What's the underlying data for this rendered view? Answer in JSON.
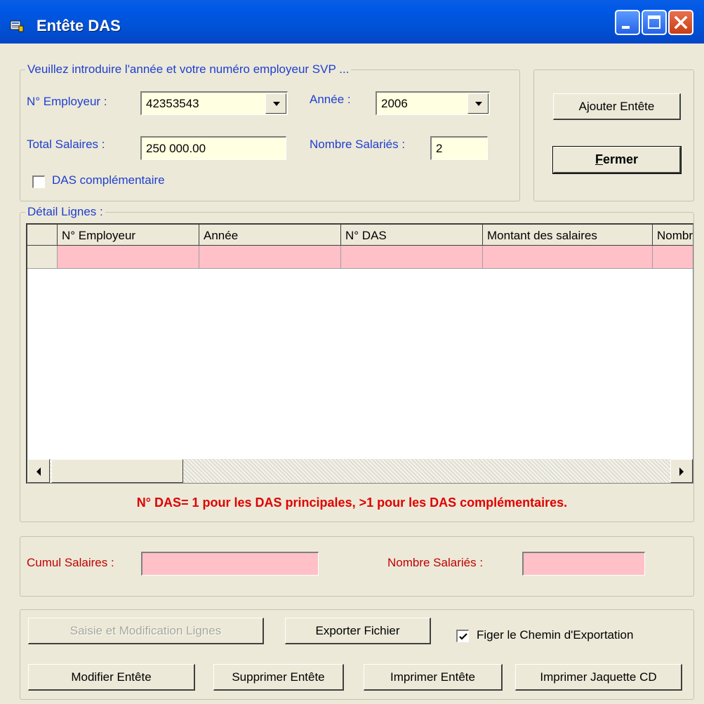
{
  "window": {
    "title": "Entête DAS"
  },
  "colors": {
    "titlebar": "#0058e6",
    "label_blue": "#1f3fd0",
    "required_pink": "#ffc0c8",
    "warning_red": "#e00000"
  },
  "header_group": {
    "legend": "Veuillez introduire l'année et votre numéro employeur SVP ...",
    "employeur_label": "N° Employeur :",
    "employeur_value": "42353543",
    "annee_label": "Année :",
    "annee_value": "2006",
    "total_label": "Total Salaires :",
    "total_value": "250 000.00",
    "nombre_label": "Nombre Salariés :",
    "nombre_value": "2",
    "complementaire_label": "DAS complémentaire",
    "complementaire_checked": false
  },
  "actions": {
    "ajouter": "Ajouter Entête",
    "fermer": "Fermer"
  },
  "detail": {
    "legend": "Détail Lignes :",
    "columns": [
      "N° Employeur",
      "Année",
      "N° DAS",
      "Montant des salaires",
      "Nombre"
    ],
    "note": "N° DAS= 1 pour les DAS principales, >1 pour les DAS complémentaires."
  },
  "totals": {
    "cumul_label": "Cumul Salaires :",
    "cumul_value": "",
    "nombre_label": "Nombre Salariés :",
    "nombre_value": ""
  },
  "bottom": {
    "saisie": "Saisie et Modification Lignes",
    "exporter": "Exporter Fichier",
    "figer_label": "Figer le Chemin d'Exportation",
    "figer_checked": true,
    "modifier": "Modifier Entête",
    "supprimer": "Supprimer Entête",
    "imprimer": "Imprimer Entête",
    "jaquette": "Imprimer Jaquette CD"
  }
}
